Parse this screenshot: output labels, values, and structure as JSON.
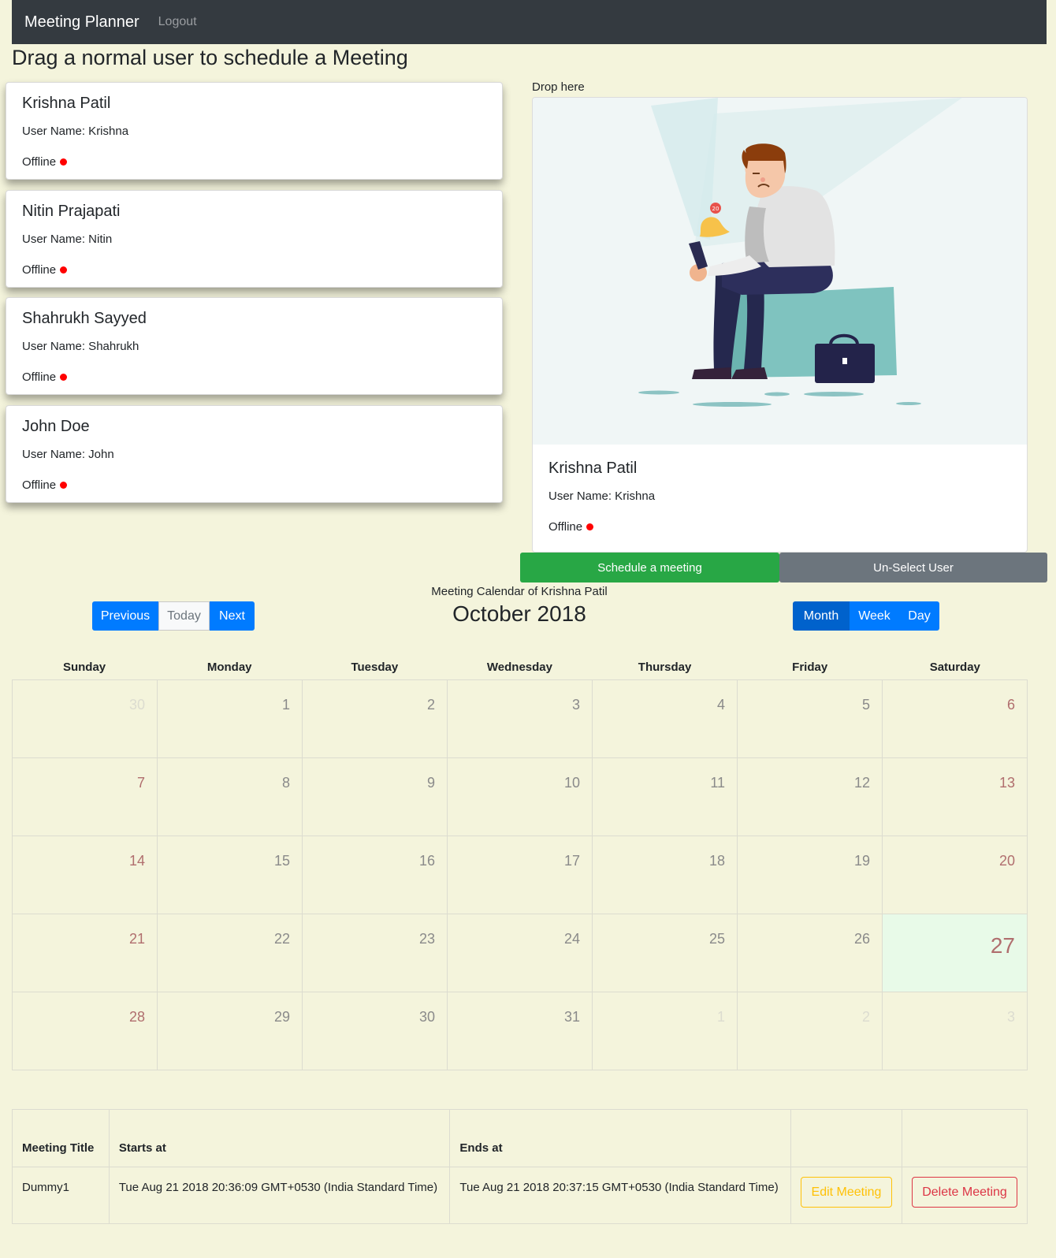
{
  "nav": {
    "brand": "Meeting Planner",
    "logout": "Logout"
  },
  "page": {
    "headline": "Drag a normal user to schedule a Meeting"
  },
  "users": [
    {
      "name": "Krishna Patil",
      "username": "User Name: Krishna",
      "status": "Offline"
    },
    {
      "name": "Nitin Prajapati",
      "username": "User Name: Nitin",
      "status": "Offline"
    },
    {
      "name": "Shahrukh Sayyed",
      "username": "User Name: Shahrukh",
      "status": "Offline"
    },
    {
      "name": "John Doe",
      "username": "User Name: John",
      "status": "Offline"
    }
  ],
  "drop": {
    "label": "Drop here",
    "selected": {
      "name": "Krishna Patil",
      "username": "User Name: Krishna",
      "status": "Offline"
    },
    "illustration_badge": "20"
  },
  "actions": {
    "schedule": "Schedule a meeting",
    "unselect": "Un-Select User"
  },
  "calendar": {
    "caption": "Meeting Calendar of Krishna Patil",
    "title": "October 2018",
    "nav_buttons": {
      "previous": "Previous",
      "today": "Today",
      "next": "Next"
    },
    "view_buttons": {
      "month": "Month",
      "week": "Week",
      "day": "Day"
    },
    "active_view": "Month",
    "weekdays": [
      "Sunday",
      "Monday",
      "Tuesday",
      "Wednesday",
      "Thursday",
      "Friday",
      "Saturday"
    ],
    "today": "27",
    "weeks": [
      [
        {
          "d": "30",
          "out": true,
          "we": false
        },
        {
          "d": "1",
          "out": false,
          "we": false
        },
        {
          "d": "2",
          "out": false,
          "we": false
        },
        {
          "d": "3",
          "out": false,
          "we": false
        },
        {
          "d": "4",
          "out": false,
          "we": false
        },
        {
          "d": "5",
          "out": false,
          "we": false
        },
        {
          "d": "6",
          "out": false,
          "we": true
        }
      ],
      [
        {
          "d": "7",
          "out": false,
          "we": true
        },
        {
          "d": "8",
          "out": false,
          "we": false
        },
        {
          "d": "9",
          "out": false,
          "we": false
        },
        {
          "d": "10",
          "out": false,
          "we": false
        },
        {
          "d": "11",
          "out": false,
          "we": false
        },
        {
          "d": "12",
          "out": false,
          "we": false
        },
        {
          "d": "13",
          "out": false,
          "we": true
        }
      ],
      [
        {
          "d": "14",
          "out": false,
          "we": true
        },
        {
          "d": "15",
          "out": false,
          "we": false
        },
        {
          "d": "16",
          "out": false,
          "we": false
        },
        {
          "d": "17",
          "out": false,
          "we": false
        },
        {
          "d": "18",
          "out": false,
          "we": false
        },
        {
          "d": "19",
          "out": false,
          "we": false
        },
        {
          "d": "20",
          "out": false,
          "we": true
        }
      ],
      [
        {
          "d": "21",
          "out": false,
          "we": true
        },
        {
          "d": "22",
          "out": false,
          "we": false
        },
        {
          "d": "23",
          "out": false,
          "we": false
        },
        {
          "d": "24",
          "out": false,
          "we": false
        },
        {
          "d": "25",
          "out": false,
          "we": false
        },
        {
          "d": "26",
          "out": false,
          "we": false
        },
        {
          "d": "27",
          "out": false,
          "we": true,
          "today": true
        }
      ],
      [
        {
          "d": "28",
          "out": false,
          "we": true
        },
        {
          "d": "29",
          "out": false,
          "we": false
        },
        {
          "d": "30",
          "out": false,
          "we": false
        },
        {
          "d": "31",
          "out": false,
          "we": false
        },
        {
          "d": "1",
          "out": true,
          "we": false
        },
        {
          "d": "2",
          "out": true,
          "we": false
        },
        {
          "d": "3",
          "out": true,
          "we": true
        }
      ]
    ]
  },
  "meetings": {
    "headers": {
      "title": "Meeting Title",
      "starts": "Starts at",
      "ends": "Ends at"
    },
    "rows": [
      {
        "title": "Dummy1",
        "starts": "Tue Aug 21 2018 20:36:09 GMT+0530 (India Standard Time)",
        "ends": "Tue Aug 21 2018 20:37:15 GMT+0530 (India Standard Time)",
        "edit": "Edit Meeting",
        "delete": "Delete Meeting"
      }
    ]
  },
  "colors": {
    "background": "#f4f4dc",
    "navbar": "#343a40",
    "primary": "#007bff",
    "success": "#28a745",
    "secondary": "#6c757d",
    "warning": "#ffc107",
    "danger": "#dc3545",
    "offline_dot": "#ff0000",
    "today_cell": "#e8fae8"
  }
}
